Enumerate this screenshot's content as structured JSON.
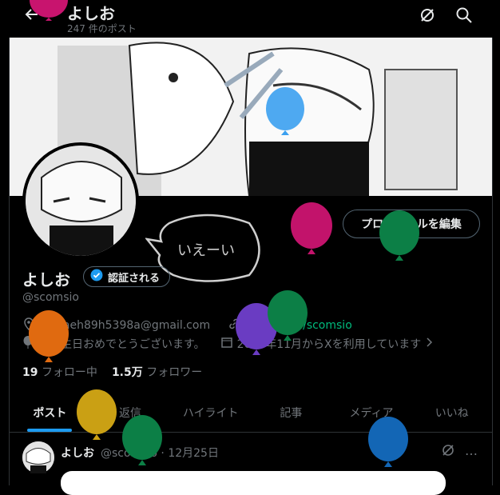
{
  "header": {
    "back_icon": "arrow-left-icon",
    "name": "よしお",
    "posts_count": "247 件のポスト"
  },
  "actions": {
    "edit_profile": "プロフィールを編集"
  },
  "profile": {
    "name": "よしお",
    "verify_label": "認証される",
    "handle": "@scomsio",
    "email": "paeh89h5398a@gmail.com",
    "website": "potofu.me/scomsio",
    "birthday": "お誕生日おめでとうございます。",
    "joined": "2016年11月からXを利用しています",
    "following_count": "19",
    "following_label": "フォロー中",
    "followers_count": "1.5万",
    "followers_label": "フォロワー",
    "bubble_text": "いえーい"
  },
  "tabs": [
    {
      "label": "ポスト"
    },
    {
      "label": "返信"
    },
    {
      "label": "ハイライト"
    },
    {
      "label": "記事"
    },
    {
      "label": "メディア"
    },
    {
      "label": "いいね"
    }
  ],
  "post": {
    "name": "よしお",
    "handle": "@scomsio",
    "separator": "·",
    "date": "12月25日",
    "more": "…"
  },
  "colors": {
    "accent": "#1d9bf0",
    "background": "#000000",
    "link": "#1d9bf0",
    "link_alt": "#00ba7c"
  }
}
